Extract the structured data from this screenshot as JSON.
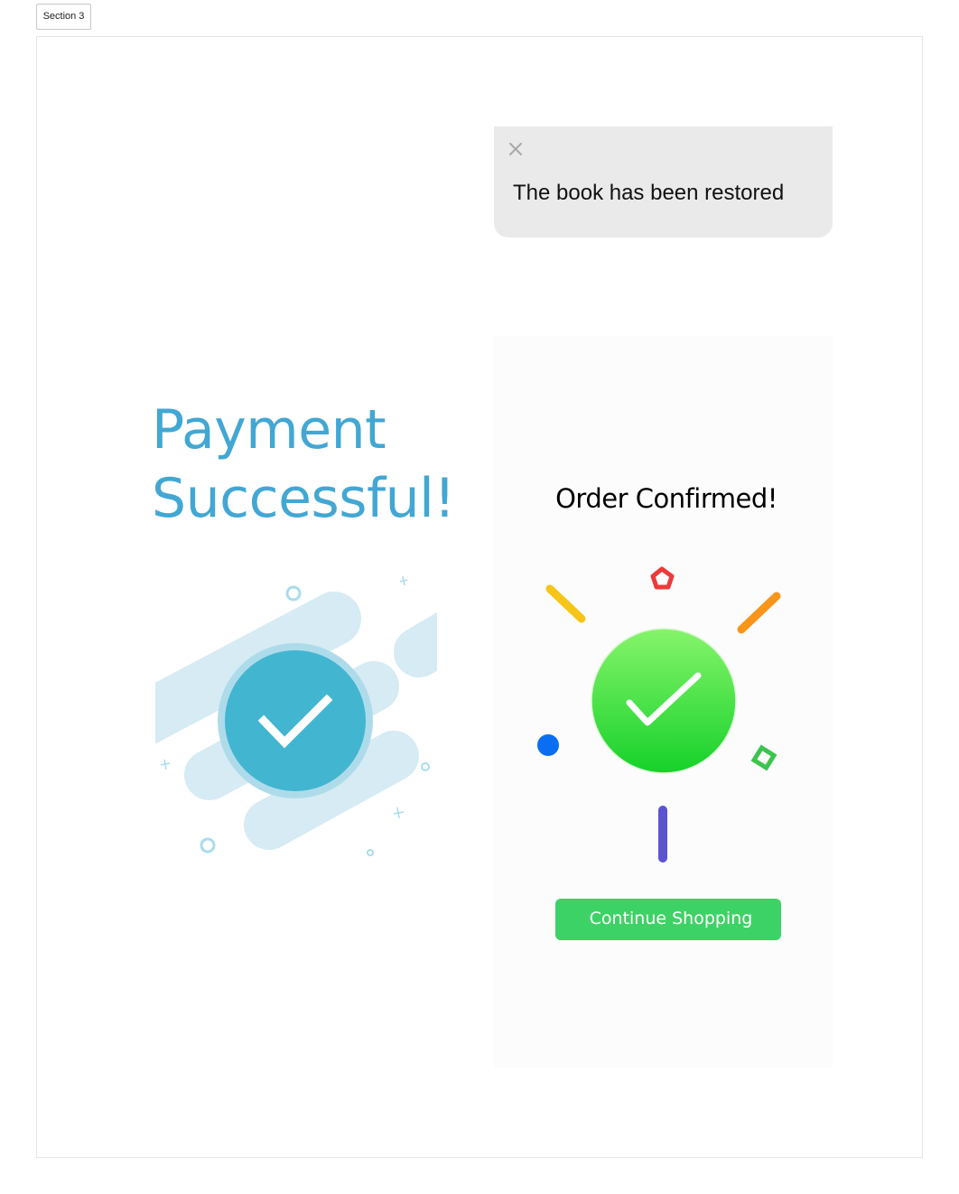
{
  "section_tag": "Section 3",
  "toast": {
    "close_icon": "close-icon",
    "message": "The book has been restored"
  },
  "payment": {
    "title_line1": "Payment",
    "title_line2": "Successful!",
    "accent_color": "#42a7d3",
    "icon": "check-circle-icon"
  },
  "order": {
    "title": "Order Confirmed!",
    "icon": "check-circle-icon",
    "button_label": "Continue Shopping",
    "button_color": "#3dd265"
  }
}
